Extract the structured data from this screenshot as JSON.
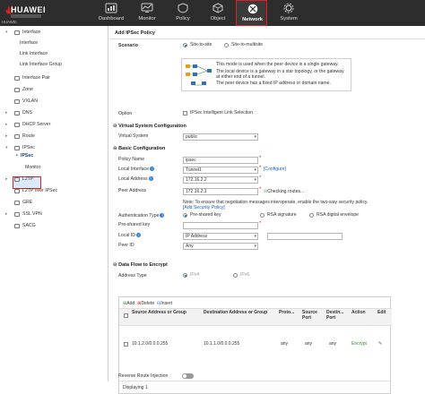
{
  "header": {
    "brand": "HUAWEI",
    "brand_caption": "HUAWEI",
    "nav": [
      {
        "label": "Dashboard",
        "icon": "dashboard-icon"
      },
      {
        "label": "Monitor",
        "icon": "monitor-icon"
      },
      {
        "label": "Policy",
        "icon": "policy-icon"
      },
      {
        "label": "Object",
        "icon": "object-icon"
      },
      {
        "label": "Network",
        "icon": "network-icon",
        "active": true
      },
      {
        "label": "System",
        "icon": "system-icon"
      }
    ]
  },
  "sidebar": {
    "items": [
      {
        "label": "Interface"
      },
      {
        "label": "Interface"
      },
      {
        "label": "Link Interface"
      },
      {
        "label": "Link Interface Group"
      },
      {
        "label": "Interface Pair"
      },
      {
        "label": "Zone"
      },
      {
        "label": "VXLAN"
      },
      {
        "label": "DNS"
      },
      {
        "label": "DHCP Server"
      },
      {
        "label": "Route"
      },
      {
        "label": "IPSec"
      },
      {
        "label": "IPSec"
      },
      {
        "label": "Monitor"
      },
      {
        "label": "L2TP"
      },
      {
        "label": "L2TP over IPSec"
      },
      {
        "label": "GRE"
      },
      {
        "label": "SSL VPN"
      },
      {
        "label": "SACG"
      }
    ]
  },
  "main": {
    "title": "Add IPSec Policy",
    "scenario": {
      "label": "Scenario",
      "options": [
        "Site-to-site",
        "Site-to-multisite"
      ],
      "selected": "Site-to-site",
      "description": [
        "This mode is used when the peer device is a single gateway.",
        "The local device is a gateway in a star topology, or the gateway at either end of a tunnel.",
        "The peer device has a fixed IP address or domain name."
      ]
    },
    "option": {
      "label": "Option",
      "checkbox_label": "IPSec Intelligent Link Selection"
    },
    "vsys": {
      "section": "Virtual System Configuration",
      "label": "Virtual System",
      "value": "public"
    },
    "basic": {
      "section": "Basic Configuration",
      "policy_name_label": "Policy Name",
      "policy_name_value": "ipsec",
      "local_interface_label": "Local Interface",
      "local_interface_value": "Tunnel1",
      "configure_link": "[Configure]",
      "local_address_label": "Local Address",
      "local_address_value": "172.16.2.2",
      "peer_address_label": "Peer Address",
      "peer_address_value": "172.16.2.1",
      "checking_routes": "Checking routes...",
      "note": "Note: To ensure that negotiation messages interoperate, enable the two-way security policy.",
      "add_security_policy": "[Add Security Policy]",
      "auth_type_label": "Authentication Type",
      "auth_options": [
        "Pre-shared key",
        "RSA signature",
        "RSA digital envelope"
      ],
      "auth_selected": "Pre-shared key",
      "psk_label": "Pre-shared key",
      "psk_value": "",
      "local_id_label": "Local ID",
      "local_id_value": "IP Address",
      "local_id_extra": "",
      "peer_id_label": "Peer ID",
      "peer_id_value": "Any"
    },
    "dataflow": {
      "section": "Data Flow to Encrypt",
      "address_type_label": "Address Type",
      "address_types": [
        "IPv4",
        "IPv6"
      ],
      "address_type_selected": "IPv4",
      "toolbar": {
        "add": "Add",
        "delete": "Delete",
        "insert": "Insert"
      },
      "columns": [
        "Source Address or Group",
        "Destination Address or Group",
        "Proto...",
        "Source Port",
        "Destin... Port",
        "Action",
        "Edit"
      ],
      "rows": [
        {
          "source": "10.1.2.0/0.0.0.255",
          "destination": "10.1.1.0/0.0.0.255",
          "protocol": "any",
          "source_port": "any",
          "dest_port": "any",
          "action": "Encrypt"
        }
      ],
      "footer": "Displaying 1"
    },
    "reverse_route": {
      "label": "Reverse Route Injection",
      "enabled": false
    }
  },
  "colors": {
    "accent": "#e02020",
    "topbar": "#2d2d2d",
    "link": "#1a5fb4",
    "encrypt": "#2e8b2e"
  }
}
